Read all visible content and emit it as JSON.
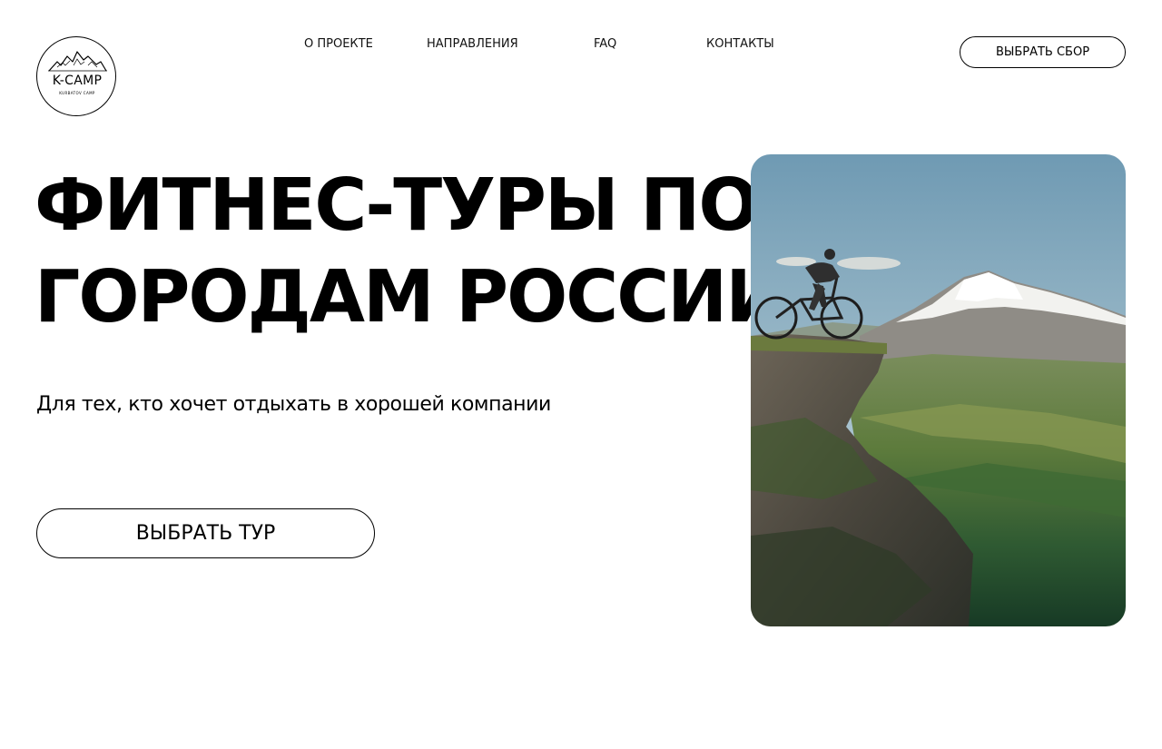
{
  "logo": {
    "title": "K-CAMP",
    "subtitle": "KURBATOV CAMP",
    "icon": "mountain-logo-icon"
  },
  "nav": {
    "items": [
      {
        "label": "О ПРОЕКТЕ"
      },
      {
        "label": "НАПРАВЛЕНИЯ"
      },
      {
        "label": "FAQ"
      },
      {
        "label": "КОНТАКТЫ"
      }
    ],
    "cta_label": "ВЫБРАТЬ СБОР"
  },
  "hero": {
    "title_line1": "ФИТНЕС-ТУРЫ ПО",
    "title_line2": "ГОРОДАМ РОССИИ",
    "subtitle": "Для тех, кто хочет отдыхать в хорошей компании",
    "cta_label": "ВЫБРАТЬ ТУР",
    "image": "cyclist-on-cliff-mountain-photo"
  },
  "colors": {
    "background": "#ffffff",
    "text": "#000000",
    "border": "#000000"
  }
}
